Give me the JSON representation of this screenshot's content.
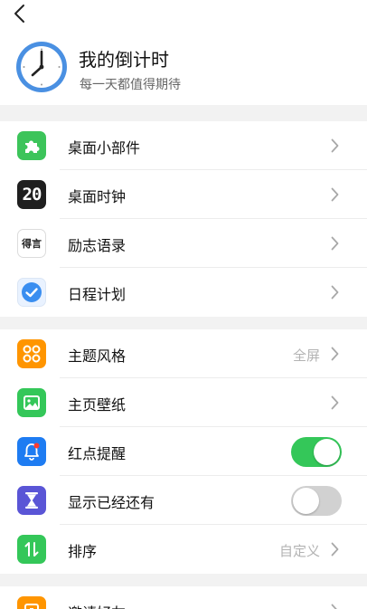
{
  "header": {
    "app_title": "我的倒计时",
    "subtitle": "每一天都值得期待"
  },
  "section1": {
    "items": [
      {
        "label": "桌面小部件",
        "icon": "puzzle-icon",
        "color": "#3cc45a"
      },
      {
        "label": "桌面时钟",
        "icon": "flip-clock-icon",
        "icon_text": "20",
        "color": "#1f1f1f"
      },
      {
        "label": "励志语录",
        "icon": "quote-icon",
        "icon_text": "得言",
        "color": "#ffffff"
      },
      {
        "label": "日程计划",
        "icon": "check-circle-icon",
        "color": "#e9f2ff"
      }
    ]
  },
  "section2": {
    "items": [
      {
        "label": "主题风格",
        "icon": "grid-icon",
        "color": "#ff9500",
        "value": "全屏"
      },
      {
        "label": "主页壁纸",
        "icon": "image-icon",
        "color": "#34c759"
      },
      {
        "label": "红点提醒",
        "icon": "bell-icon",
        "color": "#1e7cf2",
        "toggle": true
      },
      {
        "label": "显示已经还有",
        "icon": "hourglass-icon",
        "color": "#5a55d6",
        "toggle": false
      },
      {
        "label": "排序",
        "icon": "sort-icon",
        "color": "#34c759",
        "value": "自定义"
      }
    ]
  },
  "section3": {
    "items": [
      {
        "label": "邀请好友",
        "icon": "invite-icon",
        "color": "#ff9500"
      }
    ]
  }
}
